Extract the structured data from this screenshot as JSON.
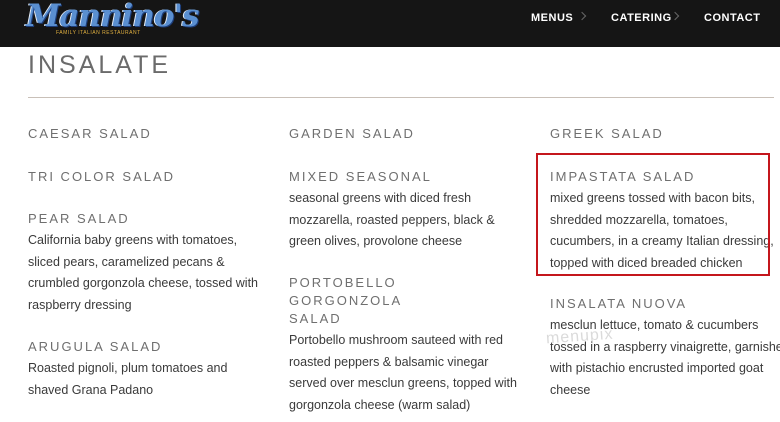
{
  "brand": {
    "logo_text": "Mannino's",
    "logo_sub": "FAMILY ITALIAN RESTAURANT"
  },
  "nav": {
    "items": [
      "MENUS",
      "CATERING",
      "CONTACT"
    ]
  },
  "section": {
    "title": "INSALATE"
  },
  "columns": [
    [
      {
        "name": "CAESAR SALAD",
        "description": ""
      },
      {
        "name": "TRI COLOR SALAD",
        "description": ""
      },
      {
        "name": "PEAR SALAD",
        "description": "California baby greens with tomatoes, sliced pears, caramelized pecans & crumbled gorgonzola cheese, tossed with raspberry dressing"
      },
      {
        "name": "ARUGULA SALAD",
        "description": "Roasted pignoli, plum tomatoes and shaved Grana Padano"
      }
    ],
    [
      {
        "name": "GARDEN SALAD",
        "description": ""
      },
      {
        "name": "MIXED SEASONAL",
        "description": "seasonal greens with diced fresh mozzarella, roasted peppers, black & green olives, provolone cheese"
      },
      {
        "name": "PORTOBELLO\nGORGONZOLA\nSALAD",
        "description": "Portobello mushroom sauteed with red roasted peppers & balsamic vinegar served over mesclun greens, topped with gorgonzola cheese (warm salad)"
      }
    ],
    [
      {
        "name": "GREEK SALAD",
        "description": ""
      },
      {
        "name": "IMPASTATA SALAD",
        "description": "mixed greens tossed with bacon bits, shredded mozzarella, tomatoes, cucumbers, in a creamy Italian dressing, topped with diced breaded chicken"
      },
      {
        "name": "INSALATA NUOVA",
        "description": "mesclun lettuce, tomato & cucumbers tossed in a raspberry vinaigrette, garnished with pistachio encrusted imported goat cheese"
      }
    ]
  ],
  "watermark": "menupix",
  "colors": {
    "topbar": "#151515",
    "highlight": "#c4161c",
    "rule": "#c9c0b8"
  }
}
